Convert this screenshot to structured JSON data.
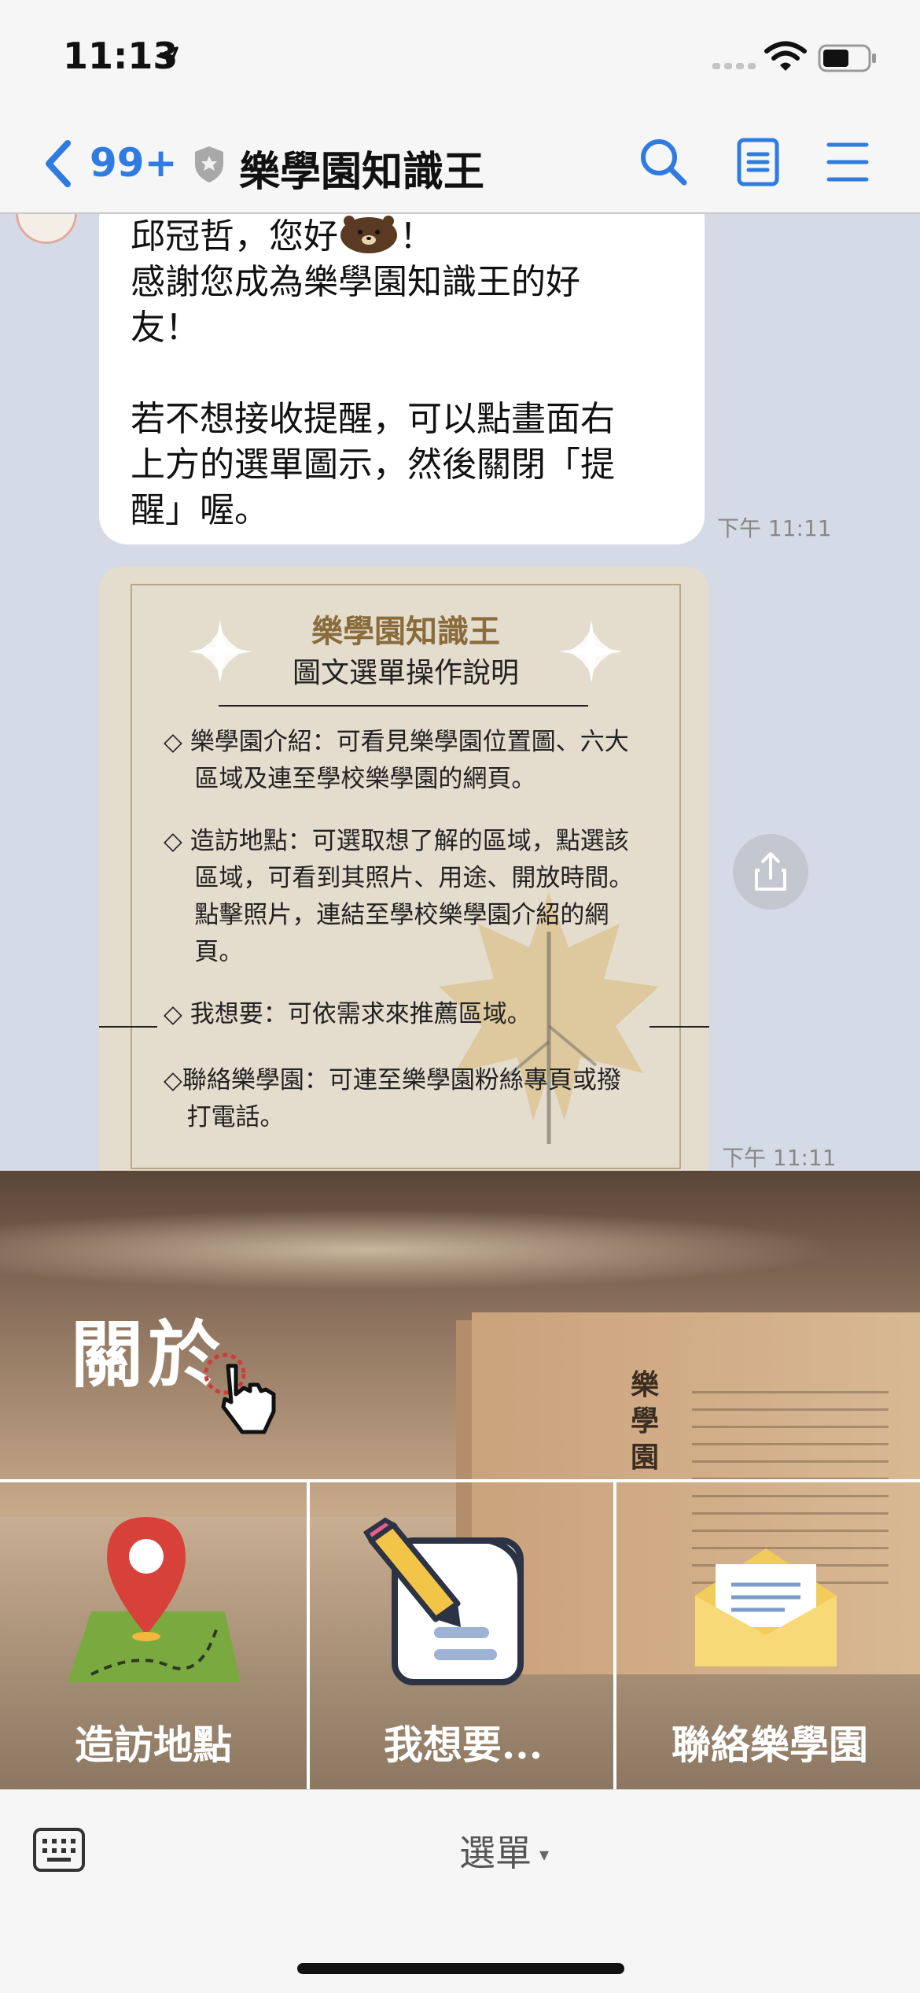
{
  "status_bar": {
    "time": "11:13",
    "icons": [
      "location-arrow-icon",
      "cellular-signal-icon",
      "wifi-icon",
      "battery-icon"
    ]
  },
  "header": {
    "back_count": "99+",
    "title": "樂學園知識王",
    "icons": [
      "back-chevron-icon",
      "shield-icon",
      "search-icon",
      "notes-icon",
      "menu-icon"
    ]
  },
  "messages": [
    {
      "type": "text",
      "greeting_before": "邱冠哲，您好",
      "greeting_after": "！",
      "body": "感謝您成為樂學園知識王的好\n友！\n\n若不想接收提醒，可以點畫面右\n上方的選單圖示，然後關閉「提\n醒」喔。",
      "time": "下午 11:11"
    },
    {
      "type": "image_card",
      "title": "樂學園知識王",
      "subtitle": "圖文選單操作說明",
      "items": [
        "◇ 樂學園介紹：可看見樂學園位置圖、六大\n    區域及連至學校樂學園的網頁。",
        "◇ 造訪地點：可選取想了解的區域，點選該\n    區域，可看到其照片、用途、開放時間。\n    點擊照片，連結至學校樂學園介紹的網\n    頁。",
        "◇ 我想要：可依需求來推薦區域。",
        "◇聯絡樂學園：可連至樂學園粉絲專頁或撥\n   打電話。"
      ],
      "time": "下午 11:11"
    }
  ],
  "rich_menu": {
    "about": "關於",
    "pillar_text": "樂學園",
    "visit": "造訪地點",
    "want": "我想要...",
    "contact": "聯絡樂學園"
  },
  "bottom_bar": {
    "menu_label": "選單",
    "caret": "▾"
  },
  "colors": {
    "accent_blue": "#2f7be2",
    "chat_background": "#d4dbe6",
    "card_background": "#e4dccd",
    "card_title": "#8a6c3c"
  }
}
